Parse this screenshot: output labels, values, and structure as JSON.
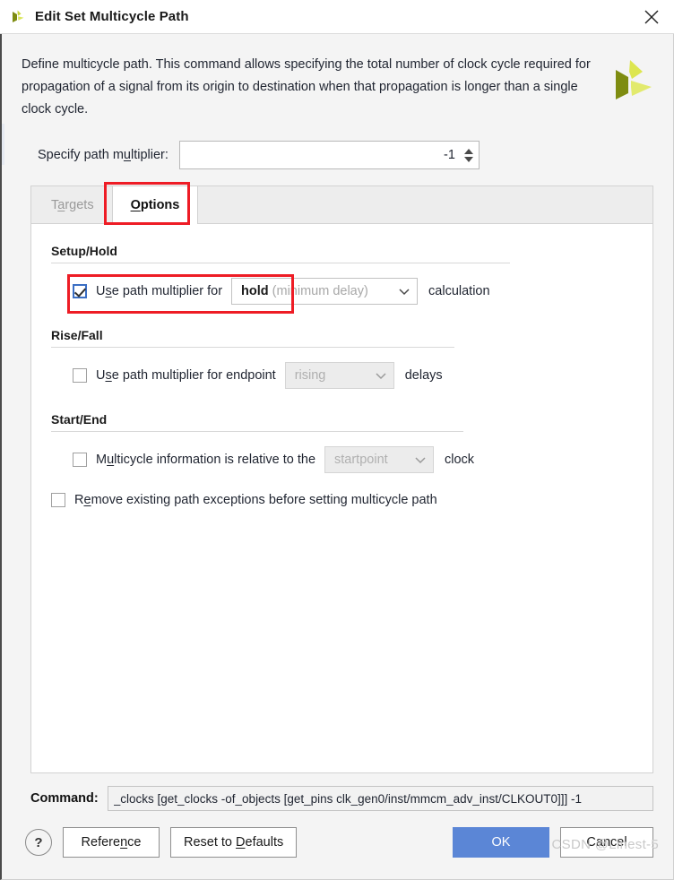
{
  "window": {
    "title": "Edit Set Multicycle Path",
    "logo_icon": "vivado-pinwheel-icon",
    "close_icon": "close-icon"
  },
  "description": {
    "text": "Define multicycle path. This command allows specifying the total number of clock cycle required for propagation of a signal from its origin to destination when that propagation is longer than a single clock cycle.",
    "brand_icon": "vivado-pinwheel-logo"
  },
  "multiplier": {
    "label": "Specify path multiplier:",
    "value": "-1",
    "spinner_up_icon": "triangle-up-icon",
    "spinner_down_icon": "triangle-down-icon"
  },
  "tabs": [
    {
      "label": "Targets",
      "active": false
    },
    {
      "label": "Options",
      "active": true
    }
  ],
  "sections": {
    "setup_hold": {
      "title": "Setup/Hold",
      "checkbox_label_pre": "Use path multiplier for",
      "checked": true,
      "combo_value": "hold",
      "combo_hint": "(minimum delay)",
      "label_post": "calculation",
      "chevron_icon": "chevron-down-icon",
      "disabled": false
    },
    "rise_fall": {
      "title": "Rise/Fall",
      "checkbox_label_pre": "Use path multiplier for endpoint",
      "checked": false,
      "combo_value": "rising",
      "label_post": "delays",
      "chevron_icon": "chevron-down-icon",
      "disabled": true
    },
    "start_end": {
      "title": "Start/End",
      "checkbox_label_pre": "Multicycle information is relative to the",
      "checked": false,
      "combo_value": "startpoint",
      "label_post": "clock",
      "chevron_icon": "chevron-down-icon",
      "disabled": true
    },
    "remove_exceptions": {
      "checkbox_label": "Remove existing path exceptions before setting multicycle path",
      "checked": false
    }
  },
  "command": {
    "label": "Command:",
    "value": "_clocks [get_clocks -of_objects [get_pins clk_gen0/inst/mmcm_adv_inst/CLKOUT0]]] -1"
  },
  "buttons": {
    "help": "?",
    "reference": "Reference",
    "reset": "Reset to Defaults",
    "ok": "OK",
    "cancel": "Cancel"
  },
  "watermark": "CSDN @Linest-5",
  "colors": {
    "accent_blue": "#5b86d6",
    "highlight_red": "#ee1c25",
    "checkbox_blue": "#3b6fc4",
    "brand_dark": "#7e8c10",
    "brand_light": "#d9e54a"
  }
}
